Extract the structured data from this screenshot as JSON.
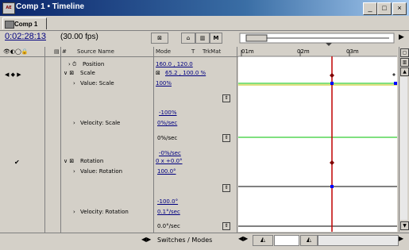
{
  "window": {
    "title": "Comp 1 • Timeline",
    "app_icon_text": "AE",
    "minimize": "_",
    "maximize": "□",
    "close": "×"
  },
  "tab": {
    "label": "Comp 1"
  },
  "header": {
    "timecode": "0:02:28:13",
    "fps": "(30.00 fps)",
    "buttons": [
      "⊠",
      "⌂",
      "▥",
      "M"
    ]
  },
  "columns": {
    "source_name": "Source Name",
    "mode": "Mode",
    "t": "T",
    "trkmat": "TrkMat",
    "ruler_ticks": [
      "01m",
      "02m",
      "03m"
    ]
  },
  "rows": {
    "position": {
      "label": "Position",
      "value": "160.0 , 120.0"
    },
    "scale": {
      "label": "Scale",
      "value": "65.2 , 100.0 %"
    },
    "value_scale": {
      "label": "Value: Scale",
      "value": "100%"
    },
    "velocity_scale": {
      "label": "Velocity: Scale",
      "value_top": "-100%",
      "value_mid": "0%/sec",
      "value_bottom": "0%/sec",
      "value_after": "-0%/sec"
    },
    "rotation": {
      "label": "Rotation",
      "value": "0 x +0.0°"
    },
    "value_rotation": {
      "label": "Value: Rotation",
      "value": "100.0°"
    },
    "velocity_rotation": {
      "label": "Velocity: Rotation",
      "value_top": "-100.0°",
      "value_mid": "0.1°/sec",
      "value_bottom": "0.0°/sec"
    }
  },
  "bottom": {
    "switches_modes": "Switches / Modes"
  },
  "colors": {
    "playhead": "#c00000",
    "curve_green": "#00c000",
    "curve_black": "#000000",
    "keyframe_blue": "#0000ff"
  }
}
